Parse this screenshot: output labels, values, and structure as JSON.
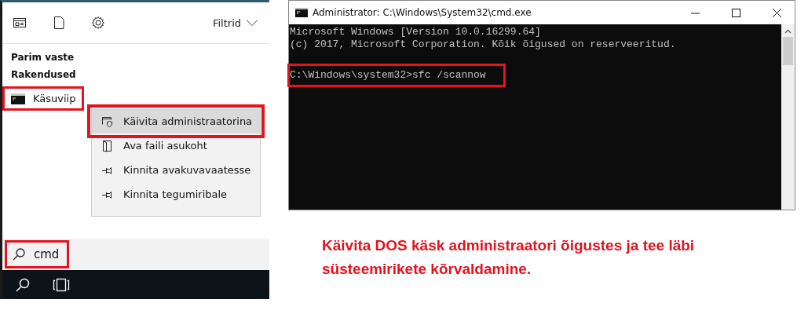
{
  "start_menu": {
    "filter_label": "Filtrid",
    "sections": [
      "Parim vaste",
      "Rakendused"
    ],
    "app": {
      "label": "Käsuviip",
      "outlined": true
    },
    "context_menu": [
      {
        "label": "Käivita administraatorina",
        "kind": "admin",
        "selected": true,
        "outlined": true
      },
      {
        "label": "Ava faili asukoht",
        "kind": "folder",
        "selected": false,
        "outlined": false
      },
      {
        "label": "Kinnita avakuvavaatesse",
        "kind": "pin",
        "selected": false,
        "outlined": false
      },
      {
        "label": "Kinnita tegumiribale",
        "kind": "pin",
        "selected": false,
        "outlined": false
      }
    ],
    "search": {
      "value": "cmd",
      "outlined": true
    }
  },
  "cmd_window": {
    "title": "Administrator: C:\\Windows\\System32\\cmd.exe",
    "lines": [
      "Microsoft Windows [Version 10.0.16299.64]",
      "(c) 2017, Microsoft Corporation. Kõik õigused on reserveeritud."
    ],
    "prompt": {
      "text": "C:\\Windows\\system32>sfc /scannow",
      "outlined": true
    }
  },
  "caption": [
    "Käivita DOS käsk administraatori õigustes ja tee läbi",
    "süsteemirikete kõrvaldamine."
  ]
}
